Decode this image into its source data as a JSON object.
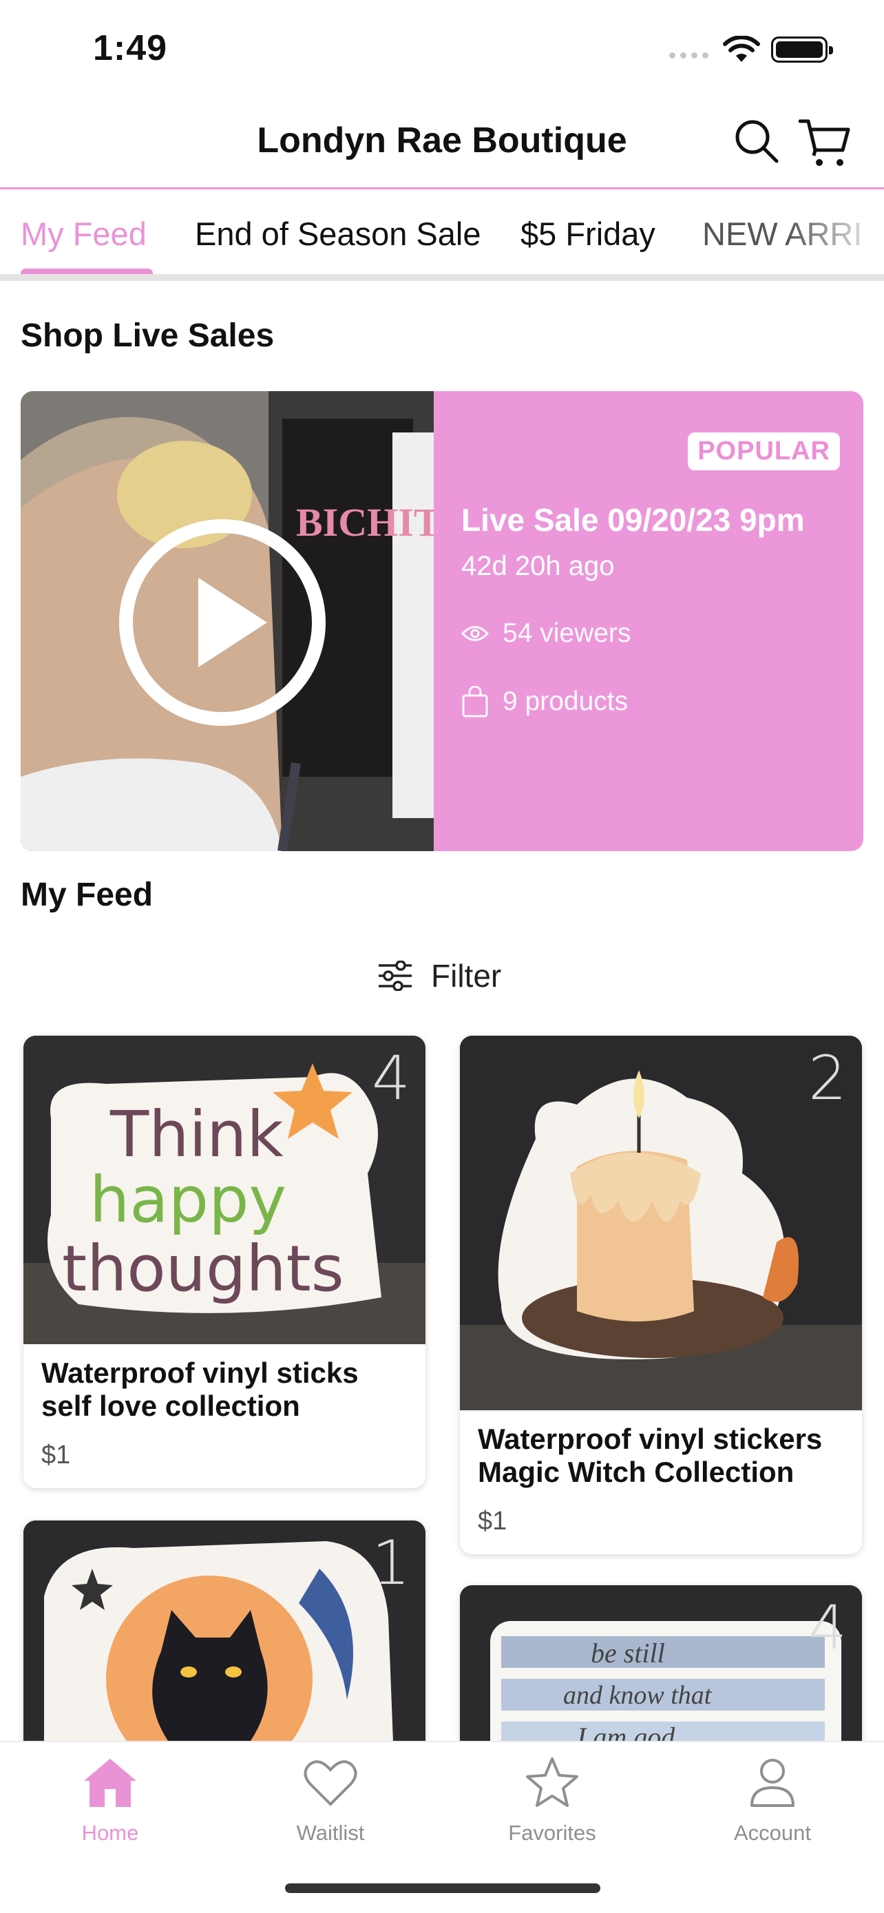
{
  "status_bar": {
    "time": "1:49"
  },
  "header": {
    "title": "Londyn Rae Boutique",
    "search_icon": "search-icon",
    "cart_icon": "cart-icon"
  },
  "tabs": [
    {
      "label": "My Feed",
      "active": true
    },
    {
      "label": "End of Season Sale"
    },
    {
      "label": "$5 Friday"
    },
    {
      "label": "NEW ARRI"
    }
  ],
  "live_section": {
    "title": "Shop Live Sales",
    "card": {
      "badge": "POPULAR",
      "title": "Live Sale 09/20/23 9pm",
      "ago": "42d 20h ago",
      "viewers": "54 viewers",
      "products": "9 products"
    }
  },
  "feed": {
    "title": "My Feed",
    "filter_label": "Filter",
    "products": [
      {
        "name": "Waterproof vinyl sticks self love collection",
        "price": "$1",
        "tag": "4",
        "image_text": [
          "Think",
          "happy",
          "thoughts"
        ]
      },
      {
        "name": "Waterproof vinyl stickers Magic Witch Collection",
        "price": "$1",
        "tag": "2"
      },
      {
        "tag": "1"
      },
      {
        "tag": "4",
        "image_text": [
          "be still",
          "and know that",
          "I am god"
        ]
      }
    ]
  },
  "tabbar": [
    {
      "label": "Home",
      "icon": "home-icon",
      "active": true
    },
    {
      "label": "Waitlist",
      "icon": "heart-icon"
    },
    {
      "label": "Favorites",
      "icon": "star-icon"
    },
    {
      "label": "Account",
      "icon": "person-icon"
    }
  ],
  "colors": {
    "accent": "#ea92d6",
    "live_card": "#ec97da"
  }
}
